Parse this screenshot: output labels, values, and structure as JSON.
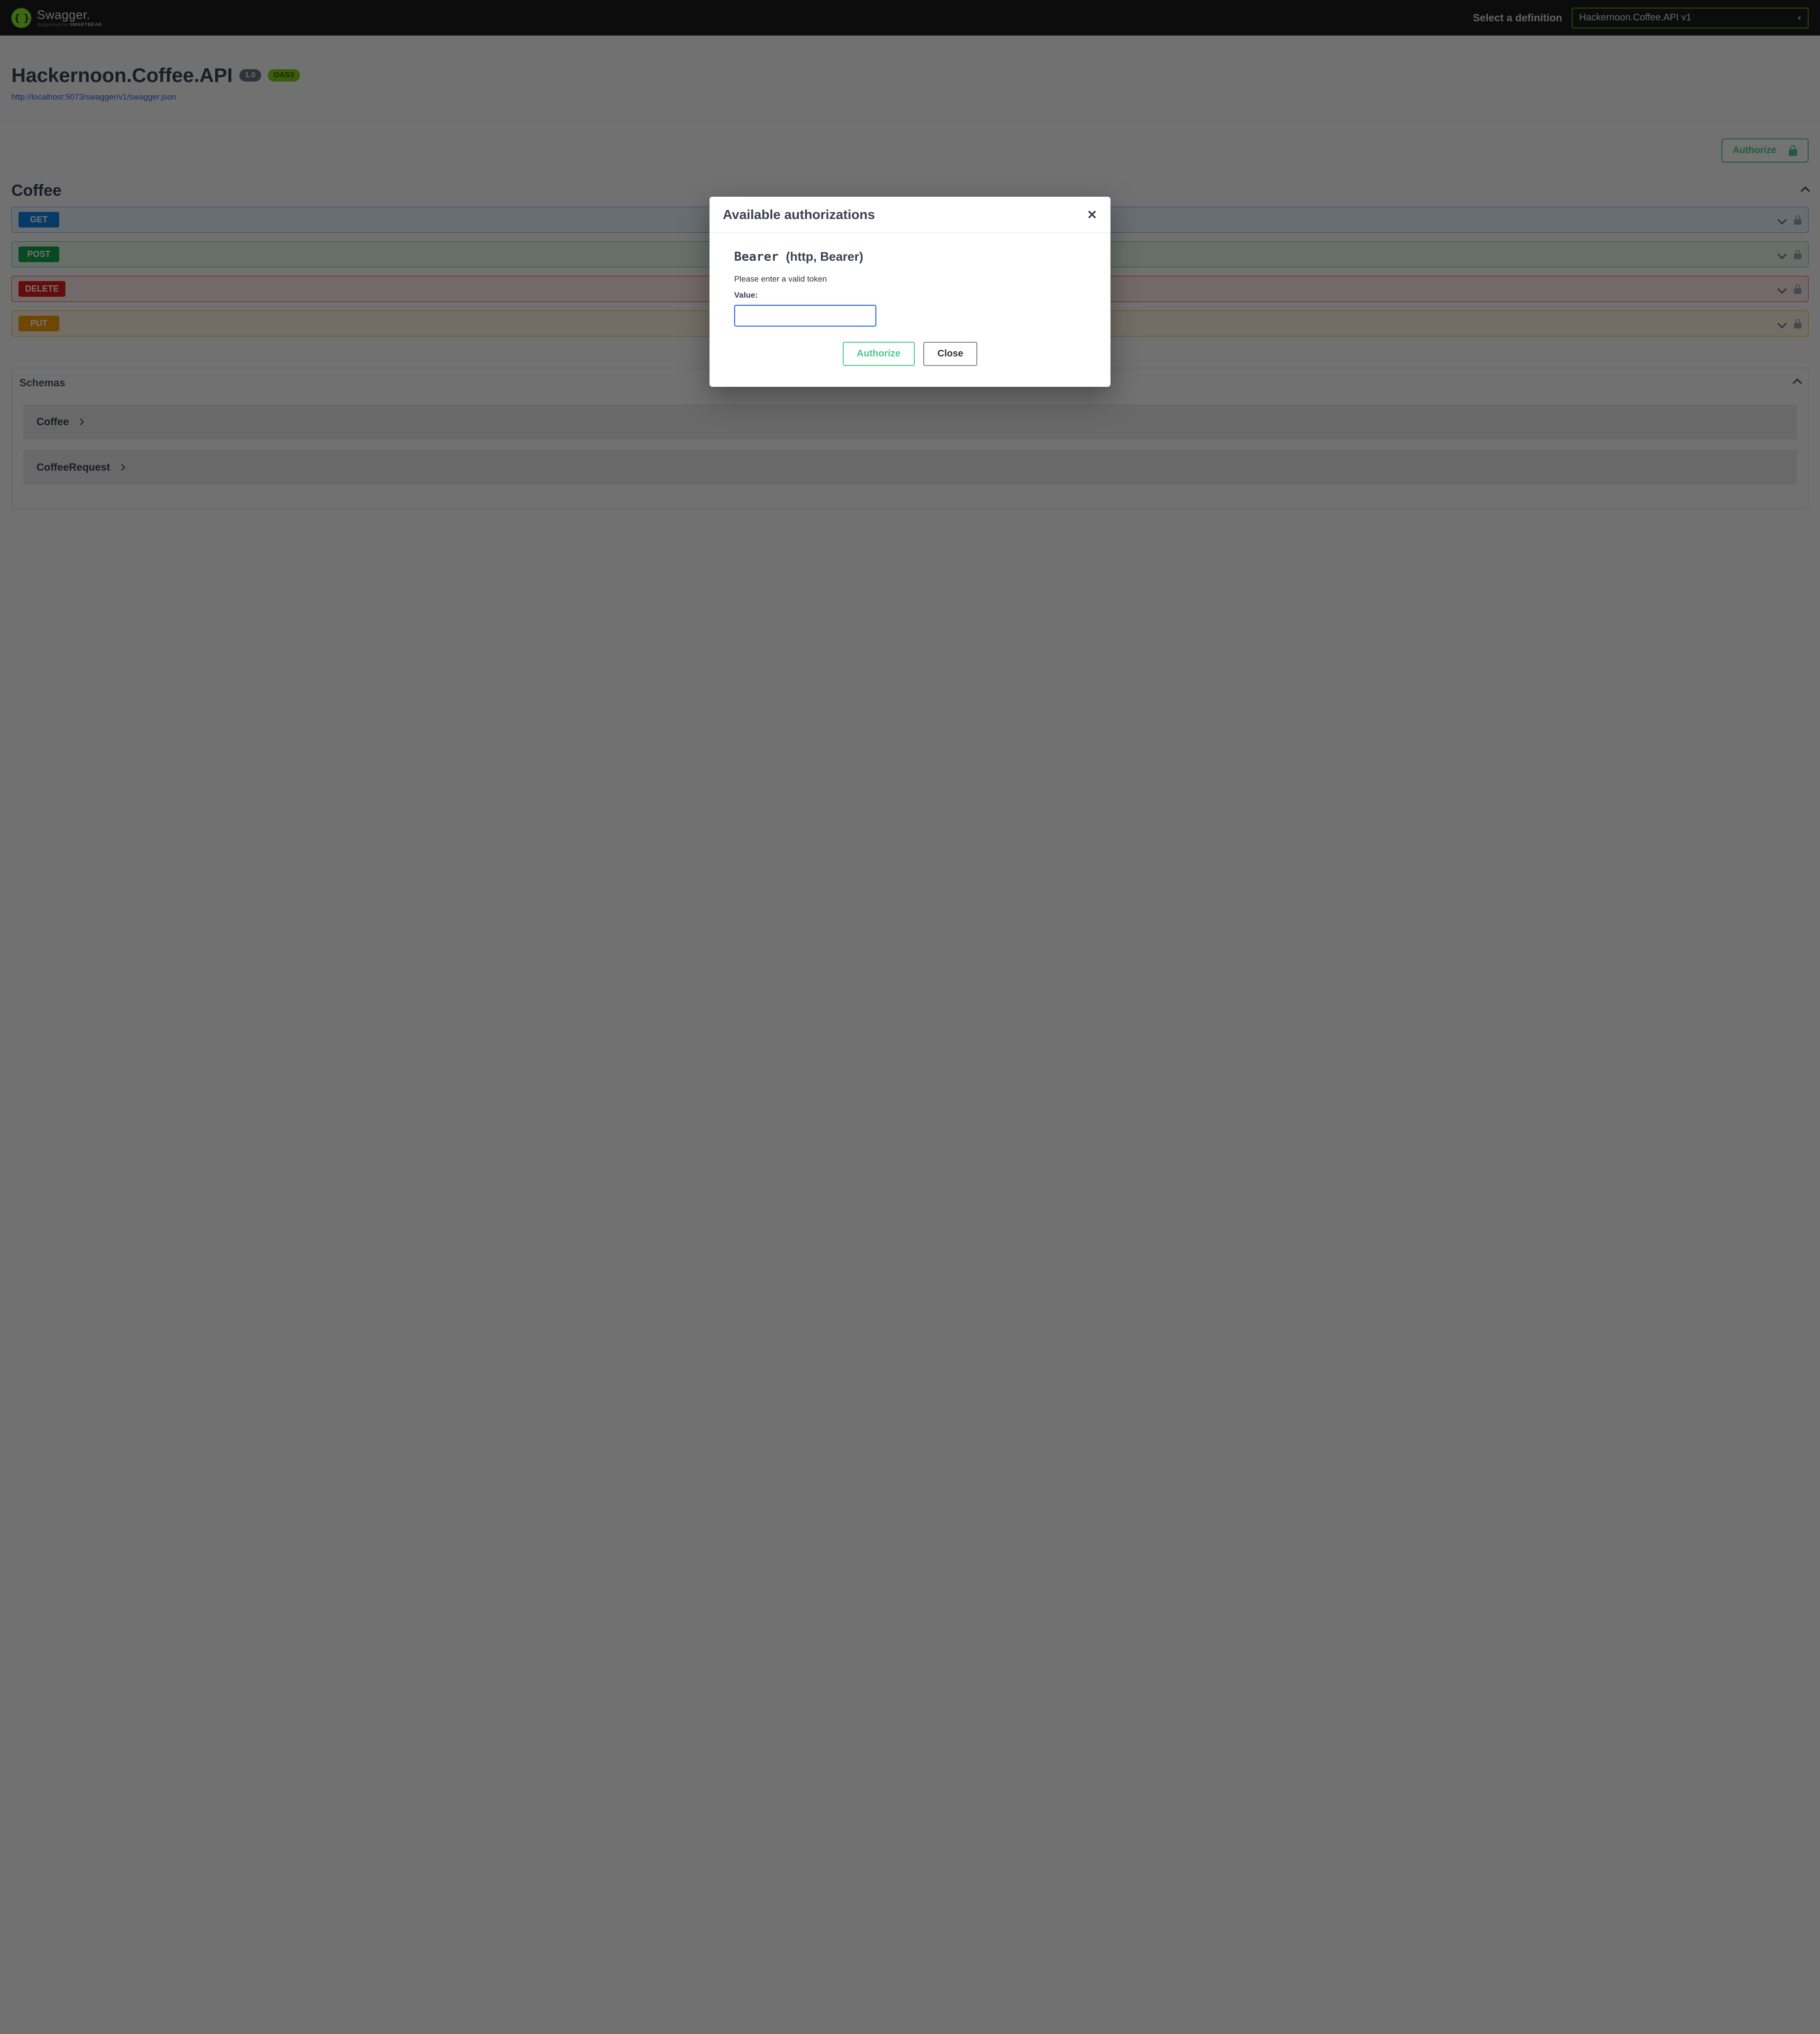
{
  "topbar": {
    "logo_main": "Swagger.",
    "logo_sub_prefix": "Supported by ",
    "logo_sub_brand": "SMARTBEAR",
    "select_label": "Select a definition",
    "selected_definition": "Hackernoon.Coffee.API v1"
  },
  "info": {
    "title": "Hackernoon.Coffee.API",
    "version": "1.0",
    "oas": "OAS3",
    "spec_url": "http://localhost:5073/swagger/v1/swagger.json"
  },
  "authorize_button": "Authorize",
  "tag": {
    "name": "Coffee",
    "ops": [
      {
        "method": "GET"
      },
      {
        "method": "POST"
      },
      {
        "method": "DELETE"
      },
      {
        "method": "PUT"
      }
    ]
  },
  "schemas": {
    "heading": "Schemas",
    "items": [
      "Coffee",
      "CoffeeRequest"
    ]
  },
  "modal": {
    "title": "Available authorizations",
    "scheme_name": "Bearer",
    "scheme_detail": "(http, Bearer)",
    "hint": "Please enter a valid token",
    "value_label": "Value:",
    "authorize": "Authorize",
    "close": "Close"
  }
}
